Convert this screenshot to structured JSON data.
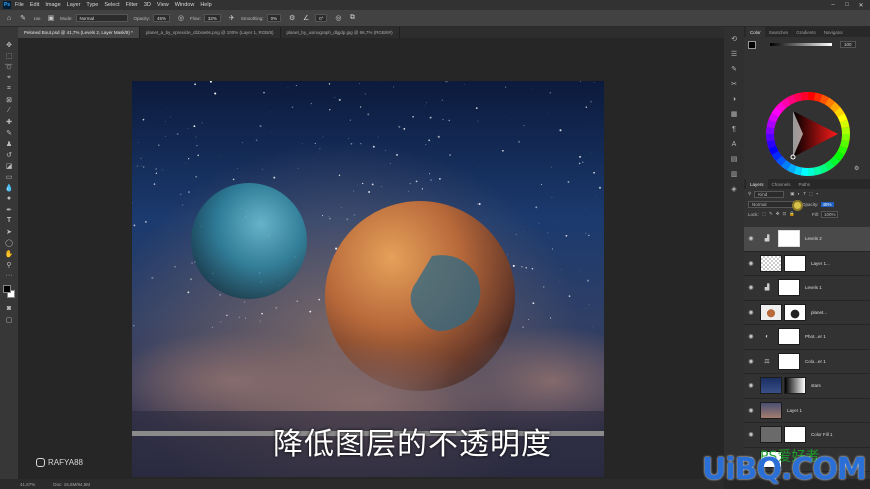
{
  "app": {
    "logo": "Ps"
  },
  "menu": [
    "File",
    "Edit",
    "Image",
    "Layer",
    "Type",
    "Select",
    "Filter",
    "3D",
    "View",
    "Window",
    "Help"
  ],
  "options": {
    "mode_label": "Mode:",
    "mode_value": "Normal",
    "opacity_label": "Opacity:",
    "opacity_value": "45%",
    "flow_label": "Flow:",
    "flow_value": "32%",
    "smoothing_label": "Smoothing:",
    "smoothing_value": "0%",
    "angle_value": "0°",
    "brush_size": "100"
  },
  "tabs": [
    "Peloned Bout.psd @ 41,7% (Levels 2, Layer Mask/8) *",
    "planet_a_by_sprexicle_d1bsw9s.png @ 100% (Layer 1, RGB/8)",
    "planet_by_usinograph_dlgjdp.jpg @ 66,7% (RGB/8#)"
  ],
  "caption": "降低图层的不透明度",
  "watermark": "RAFYA88",
  "status": {
    "zoom": "41,67%",
    "doc": "Doc: 15,6M/94,5M"
  },
  "panels": {
    "color_tabs": [
      "Color",
      "Swatches",
      "Gradients",
      "Navigator"
    ],
    "color_value": "100",
    "layer_tabs": [
      "Layers",
      "Channels",
      "Paths"
    ],
    "filter_kind": "Kind",
    "blend_mode": "Normal",
    "opacity_label": "Opacity:",
    "opacity_value": "45%",
    "lock_label": "Lock:",
    "fill_label": "Fill:",
    "fill_value": "100%"
  },
  "layers": [
    {
      "name": "Levels 2",
      "kind": "adjustment",
      "selected": true
    },
    {
      "name": "Layer 1...",
      "kind": "image"
    },
    {
      "name": "Levels 1",
      "kind": "adjustment"
    },
    {
      "name": "planet...",
      "kind": "image"
    },
    {
      "name": "Phot...er 1",
      "kind": "adjustment"
    },
    {
      "name": "Colo...er 1",
      "kind": "adjustment"
    },
    {
      "name": "stars",
      "kind": "image"
    },
    {
      "name": "Layer 1",
      "kind": "image"
    },
    {
      "name": "Color Fill 1",
      "kind": "fill"
    },
    {
      "name": "",
      "kind": "image"
    }
  ],
  "site_watermark": {
    "logo": "UiBQ.COM",
    "sub": "PS爱好者"
  }
}
